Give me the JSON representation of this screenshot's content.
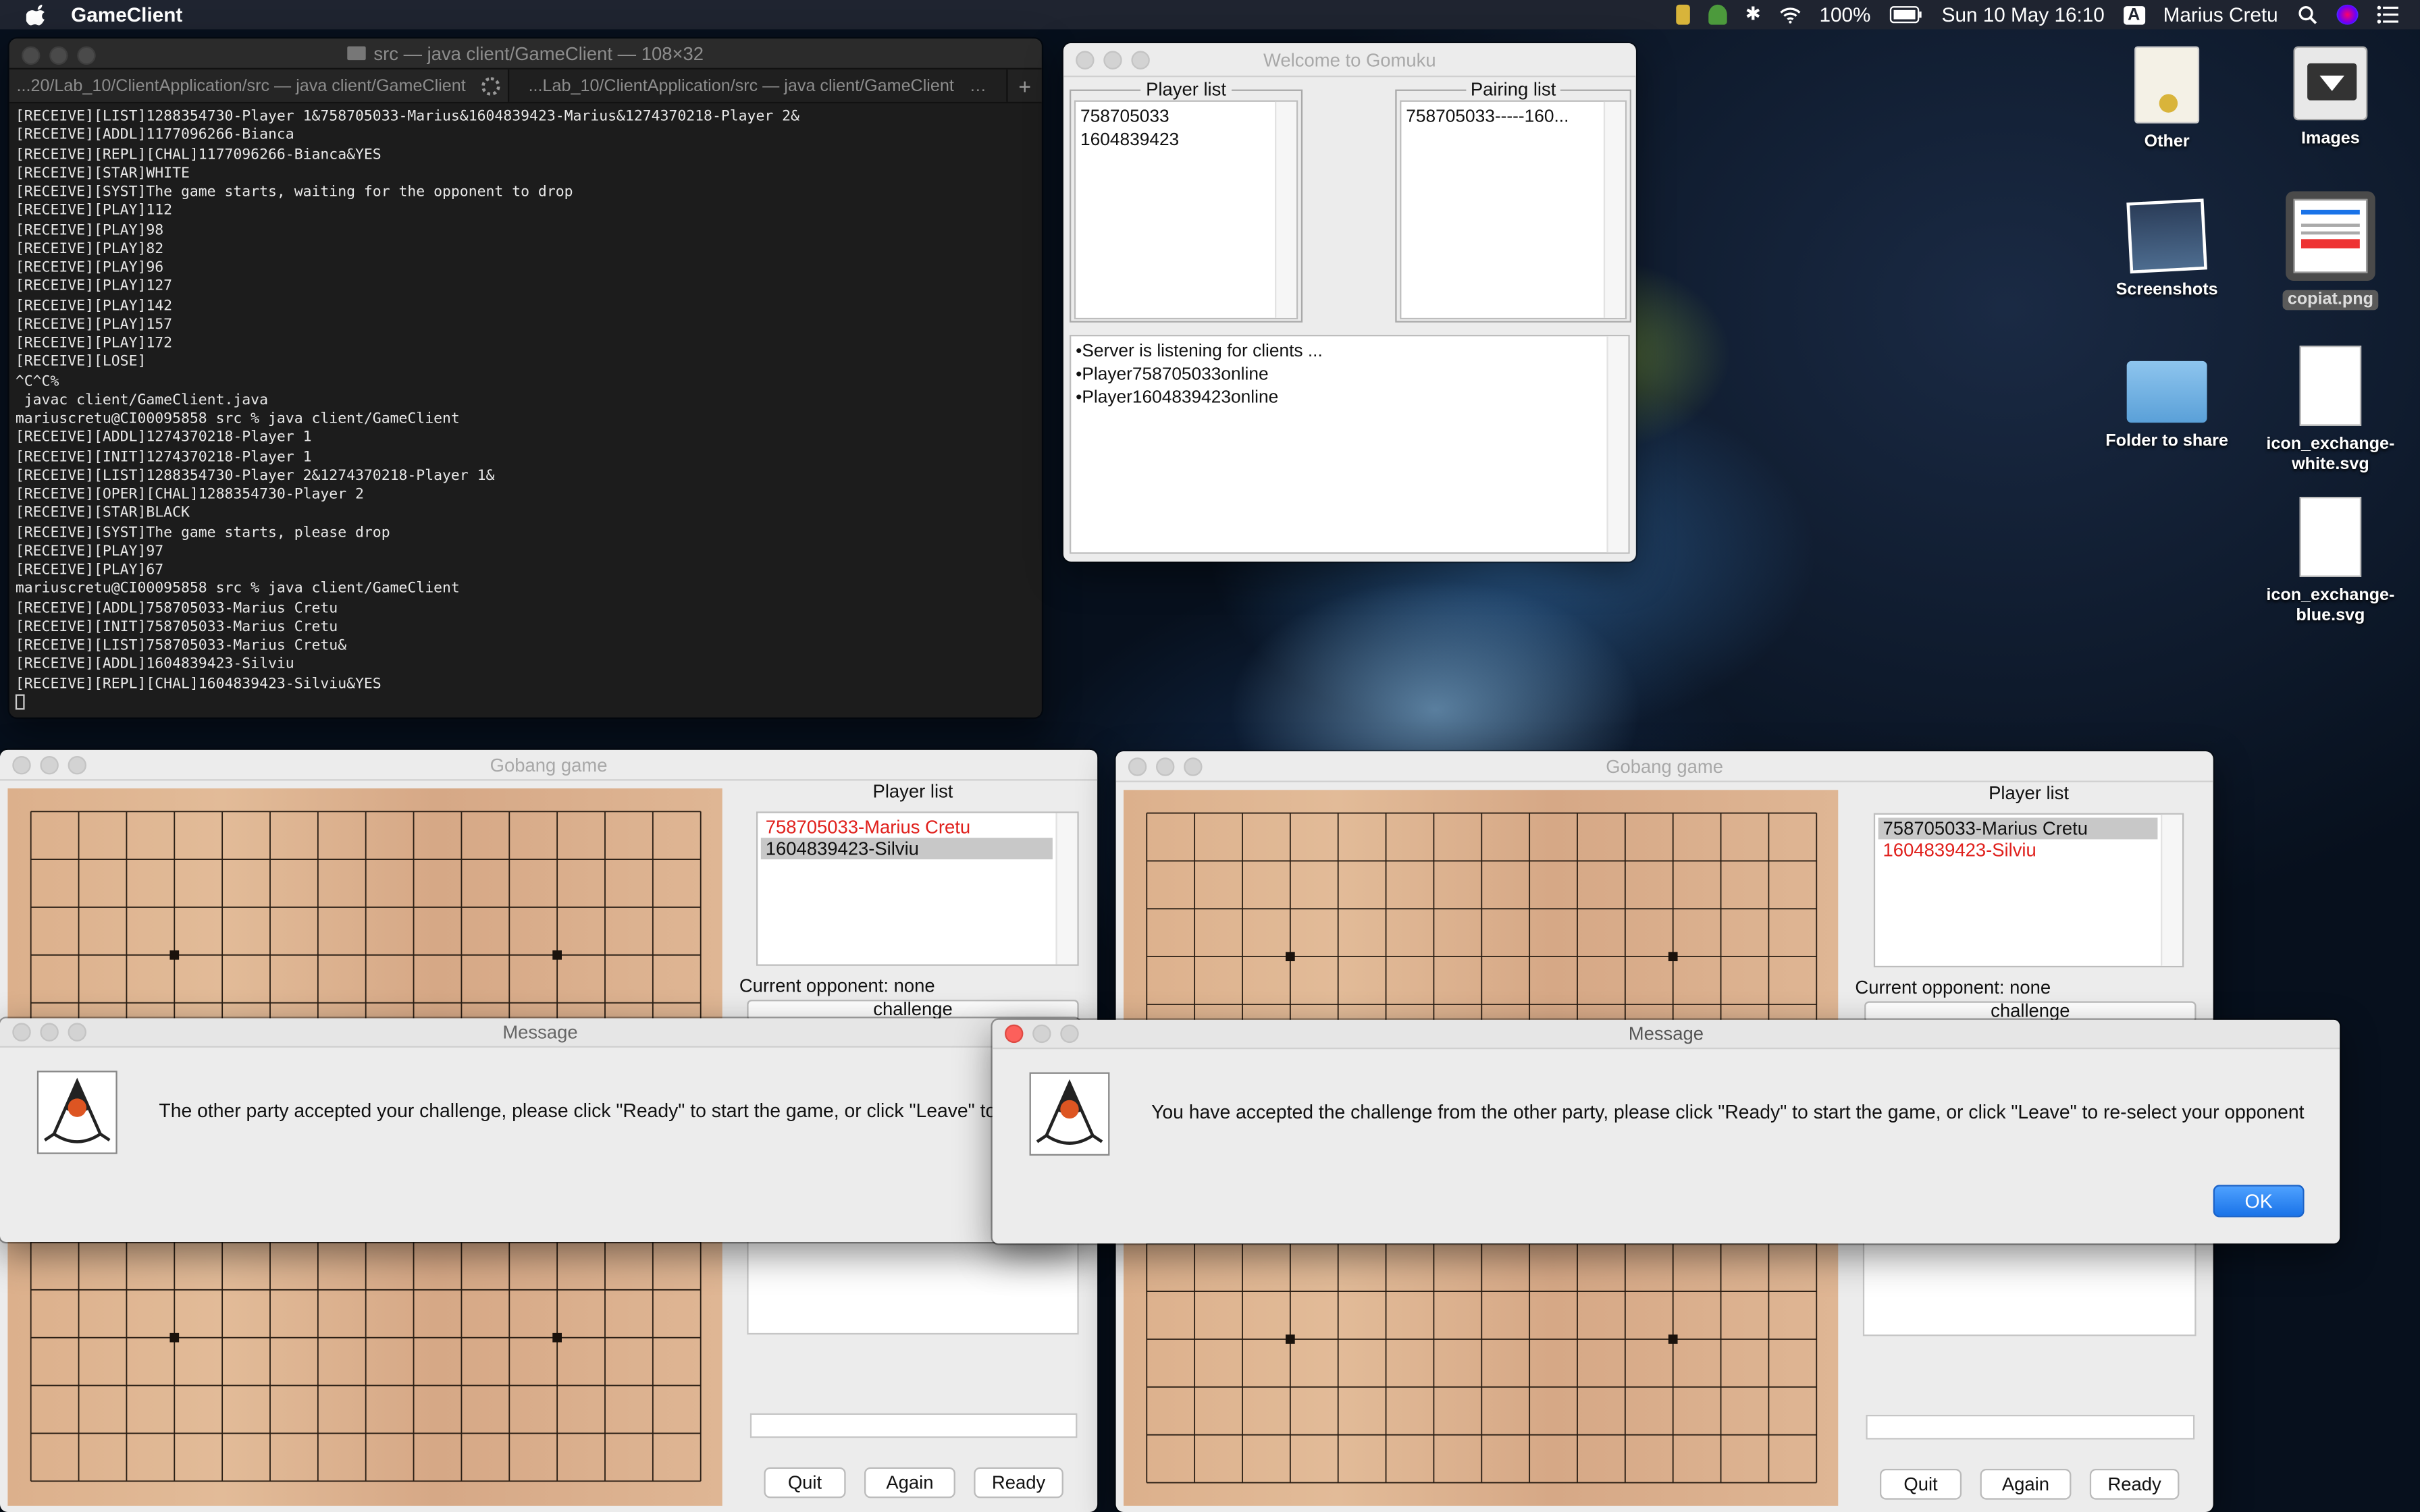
{
  "menubar": {
    "app_name": "GameClient",
    "battery": "100%",
    "datetime": "Sun 10 May  16:10",
    "input_source": "A",
    "user": "Marius Cretu"
  },
  "terminal": {
    "title": "src — java client/GameClient — 108×32",
    "tabs": [
      "...20/Lab_10/ClientApplication/src — java client/GameClient",
      "...Lab_10/ClientApplication/src — java client/GameClient"
    ],
    "tab_plus": "+",
    "prompt_right": "mariuscretu@CI00095858 src %",
    "lines": [
      "[RECEIVE][LIST]1288354730-Player 1&758705033-Marius&1604839423-Marius&1274370218-Player 2&",
      "[RECEIVE][ADDL]1177096266-Bianca",
      "[RECEIVE][REPL][CHAL]1177096266-Bianca&YES",
      "[RECEIVE][STAR]WHITE",
      "[RECEIVE][SYST]The game starts, waiting for the opponent to drop",
      "[RECEIVE][PLAY]112",
      "[RECEIVE][PLAY]98",
      "[RECEIVE][PLAY]82",
      "[RECEIVE][PLAY]96",
      "[RECEIVE][PLAY]127",
      "[RECEIVE][PLAY]142",
      "[RECEIVE][PLAY]157",
      "[RECEIVE][PLAY]172",
      "[RECEIVE][LOSE]",
      "^C^C%",
      " javac client/GameClient.java",
      "mariuscretu@CI00095858 src % java client/GameClient",
      "[RECEIVE][ADDL]1274370218-Player 1",
      "[RECEIVE][INIT]1274370218-Player 1",
      "[RECEIVE][LIST]1288354730-Player 2&1274370218-Player 1&",
      "[RECEIVE][OPER][CHAL]1288354730-Player 2",
      "[RECEIVE][STAR]BLACK",
      "[RECEIVE][SYST]The game starts, please drop",
      "[RECEIVE][PLAY]97",
      "[RECEIVE][PLAY]67",
      "mariuscretu@CI00095858 src % java client/GameClient",
      "[RECEIVE][ADDL]758705033-Marius Cretu",
      "[RECEIVE][INIT]758705033-Marius Cretu",
      "[RECEIVE][LIST]758705033-Marius Cretu&",
      "[RECEIVE][ADDL]1604839423-Silviu",
      "[RECEIVE][REPL][CHAL]1604839423-Silviu&YES"
    ]
  },
  "server": {
    "title": "Welcome to Gomuku",
    "player_list_title": "Player list",
    "pairing_list_title": "Pairing list",
    "players": [
      "758705033",
      "1604839423"
    ],
    "pairings": [
      "758705033-----160..."
    ],
    "log": [
      "•Server is listening for clients  ...",
      "•Player758705033online",
      "•Player1604839423online"
    ]
  },
  "game_left": {
    "title": "Gobang game",
    "player_list_title": "Player list",
    "players": [
      {
        "text": "758705033-Marius Cretu",
        "color": "#e0201c",
        "selected": false
      },
      {
        "text": "1604839423-Silviu",
        "color": "#111111",
        "selected": true
      }
    ],
    "opponent": "Current opponent: none",
    "challenge": "challenge",
    "buttons": {
      "quit": "Quit",
      "again": "Again",
      "ready": "Ready"
    }
  },
  "game_right": {
    "title": "Gobang game",
    "player_list_title": "Player list",
    "players": [
      {
        "text": "758705033-Marius Cretu",
        "color": "#111111",
        "selected": true
      },
      {
        "text": "1604839423-Silviu",
        "color": "#e0201c",
        "selected": false
      }
    ],
    "opponent": "Current opponent: none",
    "challenge": "challenge",
    "buttons": {
      "quit": "Quit",
      "again": "Again",
      "ready": "Ready"
    }
  },
  "message_left": {
    "title": "Message",
    "text": "The other party accepted your challenge, please click \"Ready\" to start the game, or click \"Leave\" to"
  },
  "message_right": {
    "title": "Message",
    "text": "You have accepted the challenge from the other party, please click \"Ready\" to start the game, or click \"Leave\" to re-select your opponent",
    "ok": "OK"
  },
  "desktop": {
    "icons": [
      "Other",
      "Images",
      "Screenshots",
      "copiat.png",
      "Folder to share",
      "icon_exchange-white.svg",
      "icon_exchange-blue.svg"
    ]
  },
  "colors": {
    "accent": "#1a73e8",
    "selected_row": "#c8c8c8",
    "red_text": "#e0201c",
    "board": "#dcb08c"
  }
}
